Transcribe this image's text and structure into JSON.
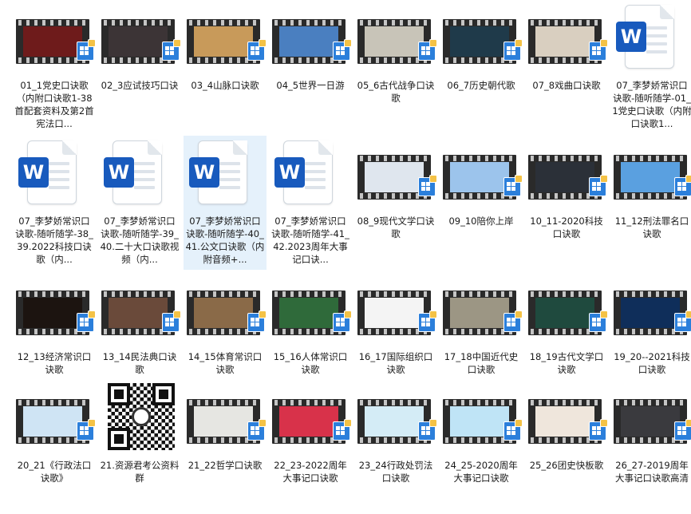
{
  "files": [
    {
      "label": "01_1党史口诀歌（内附口诀歌1-38首配套资料及第2首宪法口...",
      "kind": "video",
      "frame": "#6e1b1b"
    },
    {
      "label": "02_3应试技巧口诀",
      "kind": "video",
      "frame": "#3c3436"
    },
    {
      "label": "03_4山脉口诀歌",
      "kind": "video",
      "frame": "#c89a5a"
    },
    {
      "label": "04_5世界一日游",
      "kind": "video",
      "frame": "#4a7fc0"
    },
    {
      "label": "05_6古代战争口诀歌",
      "kind": "video",
      "frame": "#c8c4b8"
    },
    {
      "label": "06_7历史朝代歌",
      "kind": "video",
      "frame": "#1f3a4a"
    },
    {
      "label": "07_8戏曲口诀歌",
      "kind": "video",
      "frame": "#d9cfc0"
    },
    {
      "label": "07_李梦娇常识口诀歌-随听随学-01_1党史口诀歌（内附口诀歌1...",
      "kind": "word"
    },
    {
      "label": "07_李梦娇常识口诀歌-随听随学-38_39.2022科技口诀歌（内...",
      "kind": "word"
    },
    {
      "label": "07_李梦娇常识口诀歌-随听随学-39_40.二十大口诀歌视频（内...",
      "kind": "word"
    },
    {
      "label": "07_李梦娇常识口诀歌-随听随学-40_41.公文口诀歌（内附音频+...",
      "kind": "word",
      "selected": true
    },
    {
      "label": "07_李梦娇常识口诀歌-随听随学-41_42.2023周年大事记口诀...",
      "kind": "word"
    },
    {
      "label": "08_9现代文学口诀歌",
      "kind": "video",
      "frame": "#dfe6ee"
    },
    {
      "label": "09_10陪你上岸",
      "kind": "video",
      "frame": "#9cc4ec"
    },
    {
      "label": "10_11-2020科技口诀歌",
      "kind": "video",
      "frame": "#2b3038"
    },
    {
      "label": "11_12刑法罪名口诀歌",
      "kind": "video",
      "frame": "#5aa0e0"
    },
    {
      "label": "12_13经济常识口诀歌",
      "kind": "video",
      "frame": "#1c1410"
    },
    {
      "label": "13_14民法典口诀歌",
      "kind": "video",
      "frame": "#6a4a3a"
    },
    {
      "label": "14_15体育常识口诀歌",
      "kind": "video",
      "frame": "#8a6a48"
    },
    {
      "label": "15_16人体常识口诀歌",
      "kind": "video",
      "frame": "#2f6a3a"
    },
    {
      "label": "16_17国际组织口诀歌",
      "kind": "video",
      "frame": "#f4f4f4"
    },
    {
      "label": "17_18中国近代史口诀歌",
      "kind": "video",
      "frame": "#9c9684"
    },
    {
      "label": "18_19古代文学口诀歌",
      "kind": "video",
      "frame": "#1f4a3e"
    },
    {
      "label": "19_20--2021科技口诀歌",
      "kind": "video",
      "frame": "#0f2e5a"
    },
    {
      "label": "20_21《行政法口诀歌》",
      "kind": "video",
      "frame": "#cfe4f4"
    },
    {
      "label": "21.资源君考公资料群",
      "kind": "qr"
    },
    {
      "label": "21_22哲学口诀歌",
      "kind": "video",
      "frame": "#e6e6e2"
    },
    {
      "label": "22_23-2022周年大事记口诀歌",
      "kind": "video",
      "frame": "#d8324a"
    },
    {
      "label": "23_24行政处罚法口诀歌",
      "kind": "video",
      "frame": "#d4ecf6"
    },
    {
      "label": "24_25-2020周年大事记口诀歌",
      "kind": "video",
      "frame": "#bfe4f6"
    },
    {
      "label": "25_26团史快板歌",
      "kind": "video",
      "frame": "#efe6dc"
    },
    {
      "label": "26_27-2019周年大事记口诀歌高清",
      "kind": "video",
      "frame": "#3a3a3e"
    }
  ]
}
